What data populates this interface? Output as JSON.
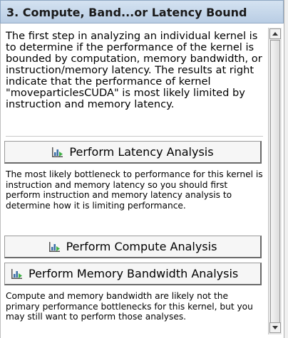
{
  "panel": {
    "title": "3. Compute, Band...or Latency Bound"
  },
  "intro_text": "The first step in analyzing an individual kernel is to determine if the performance of the kernel is bounded by computation, memory bandwidth, or instruction/memory latency.  The results at right indicate that the performance of kernel \"moveparticlesCUDA\" is most likely limited by instruction and memory latency.",
  "latency": {
    "button_label": "Perform Latency Analysis",
    "button_icon": "chart-icon",
    "note": "The most likely bottleneck to performance for this kernel is instruction and memory latency so you should first perform instruction and memory latency analysis to determine how it is limiting performance."
  },
  "compute": {
    "button_label": "Perform Compute Analysis",
    "button_icon": "chart-icon"
  },
  "bandwidth": {
    "button_label": "Perform Memory Bandwidth Analysis",
    "button_icon": "chart-icon"
  },
  "footer_note": "Compute and memory bandwidth are likely not the primary performance bottlenecks for this kernel, but you may still want to perform those analyses.",
  "colors": {
    "header_bg": "#c6d7ea",
    "icon_bars": "#3a6ea5",
    "icon_arrow": "#3cb043"
  }
}
